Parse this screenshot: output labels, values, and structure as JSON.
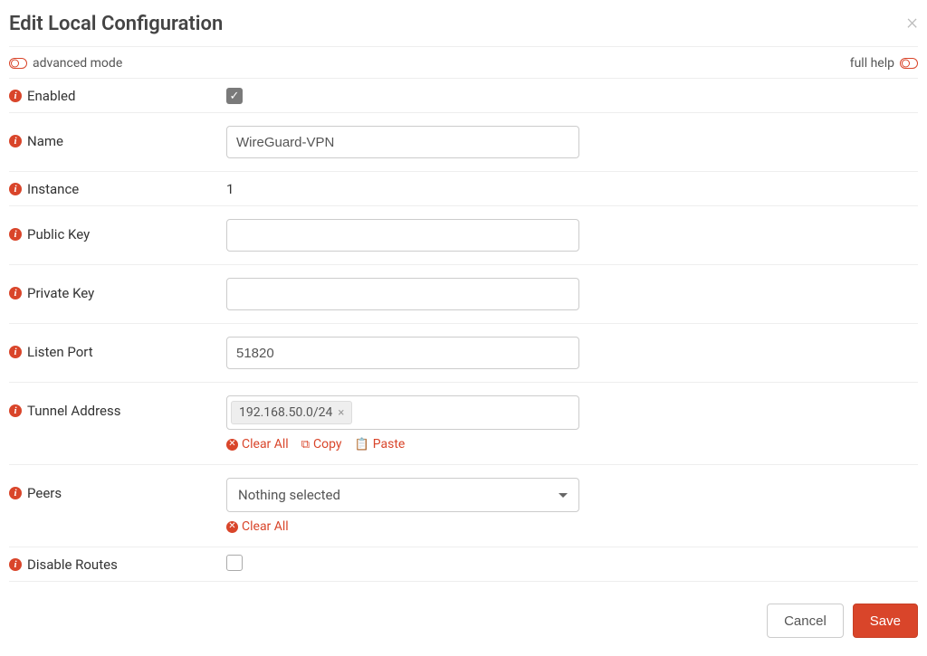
{
  "modal": {
    "title": "Edit Local Configuration",
    "advanced_mode_label": "advanced mode",
    "full_help_label": "full help"
  },
  "labels": {
    "enabled": "Enabled",
    "name": "Name",
    "instance": "Instance",
    "public_key": "Public Key",
    "private_key": "Private Key",
    "listen_port": "Listen Port",
    "tunnel_address": "Tunnel Address",
    "peers": "Peers",
    "disable_routes": "Disable Routes"
  },
  "values": {
    "enabled_checked": true,
    "name": "WireGuard-VPN",
    "instance": "1",
    "public_key": "",
    "private_key": "",
    "listen_port": "51820",
    "tunnel_address_tags": [
      "192.168.50.0/24"
    ],
    "peers_selected": "Nothing selected",
    "disable_routes_checked": false
  },
  "actions": {
    "clear_all": "Clear All",
    "copy": "Copy",
    "paste": "Paste"
  },
  "footer": {
    "cancel": "Cancel",
    "save": "Save"
  }
}
